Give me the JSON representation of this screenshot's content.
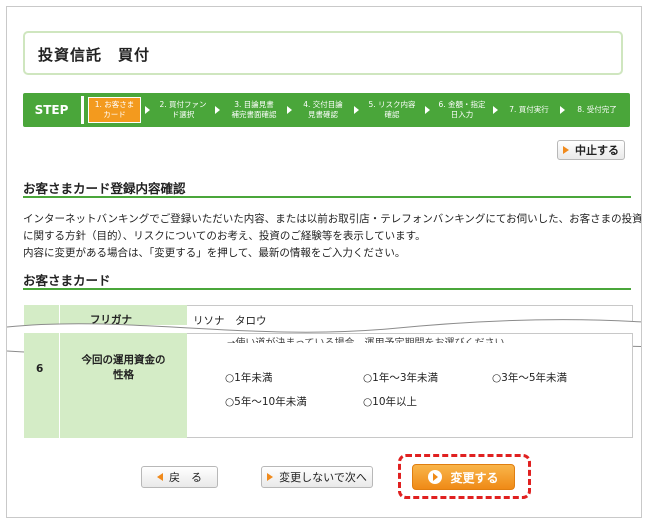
{
  "page": {
    "title": "投資信託　買付"
  },
  "steps": {
    "label": "STEP",
    "items": [
      {
        "label": "1. お客さま\nカード",
        "active": true
      },
      {
        "label": "2. 買付ファン\nド選択",
        "active": false
      },
      {
        "label": "3. 目論見書\n補完書面確認",
        "active": false
      },
      {
        "label": "4. 交付目論\n見書確認",
        "active": false
      },
      {
        "label": "5. リスク内容\n確認",
        "active": false
      },
      {
        "label": "6. 金額・指定\n日入力",
        "active": false
      },
      {
        "label": "7. 買付実行",
        "active": false
      },
      {
        "label": "8. 受付完了",
        "active": false
      }
    ]
  },
  "actions": {
    "cancel": "中止する",
    "back": "戻　る",
    "next_no_change": "変更しないで次へ",
    "change": "変更する"
  },
  "section1": {
    "heading": "お客さまカード登録内容確認",
    "lines": [
      "インターネットバンキングでご登録いただいた内容、または以前お取引店・テレフォンバンキングにてお伺いした、お客さまの投資",
      "に関する方針（目的）、リスクについてのお考え、投資のご経験等を表示しています。",
      "内容に変更がある場合は、「変更する」を押して、最新の情報をご入力ください。"
    ]
  },
  "section2": {
    "heading": "お客さまカード"
  },
  "table": {
    "partial_top_label": "フリガナ",
    "partial_top_value": "リソナ　タロウ",
    "partial_row_text": "→使い道が決まっている場合、運用予定期間をお選びください",
    "row": {
      "number": "6",
      "label_line1": "今回の運用資金の",
      "label_line2": "性格",
      "options": [
        "1年未満",
        "1年〜3年未満",
        "3年〜5年未満",
        "5年〜10年未満",
        "10年以上"
      ]
    }
  },
  "colors": {
    "accent": "#4aa63a",
    "active_step": "#f39a1e",
    "highlight": "#e02020",
    "label_bg": "#d4ecc6"
  }
}
